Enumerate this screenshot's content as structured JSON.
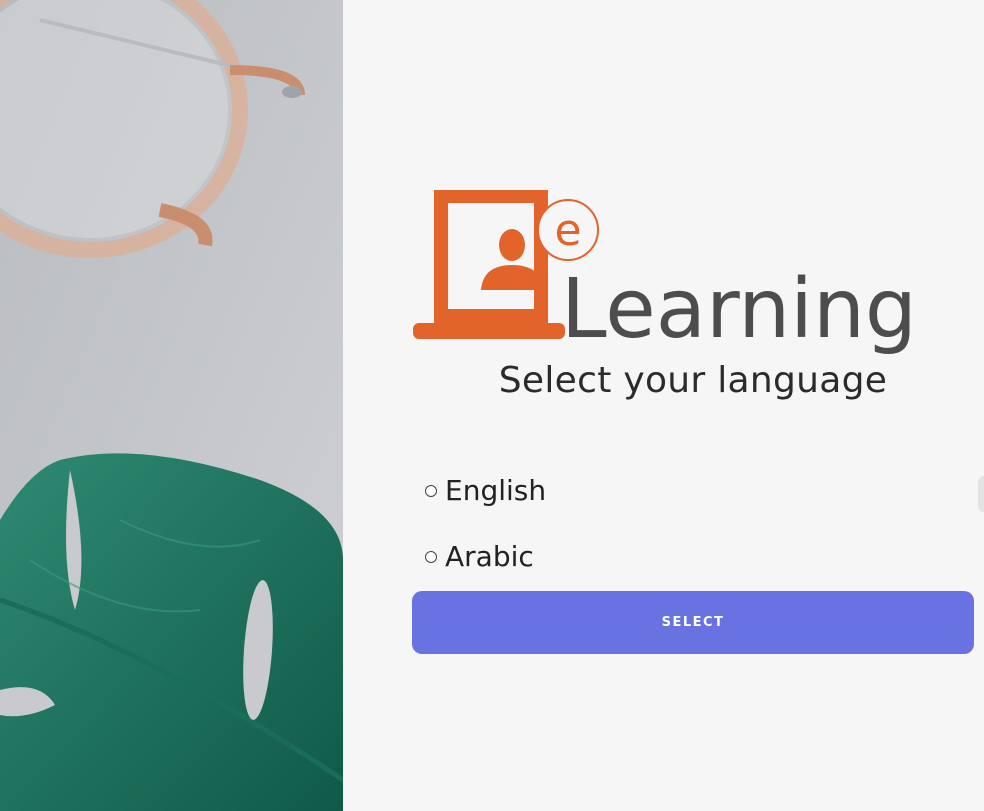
{
  "logo": {
    "badge_text": "e",
    "wordmark": "Learning",
    "colors": {
      "orange": "#e2642a",
      "dark": "#4d4d4d"
    }
  },
  "main": {
    "title": "Select your language",
    "options": [
      {
        "label": "English",
        "selected": false
      },
      {
        "label": "Arabic",
        "selected": false
      }
    ],
    "select_button": "SELECT"
  },
  "colors": {
    "button": "#6872e0",
    "background": "#f6f6f6"
  },
  "icons": [
    "glasses-image",
    "monstera-leaf-image",
    "person-icon"
  ]
}
